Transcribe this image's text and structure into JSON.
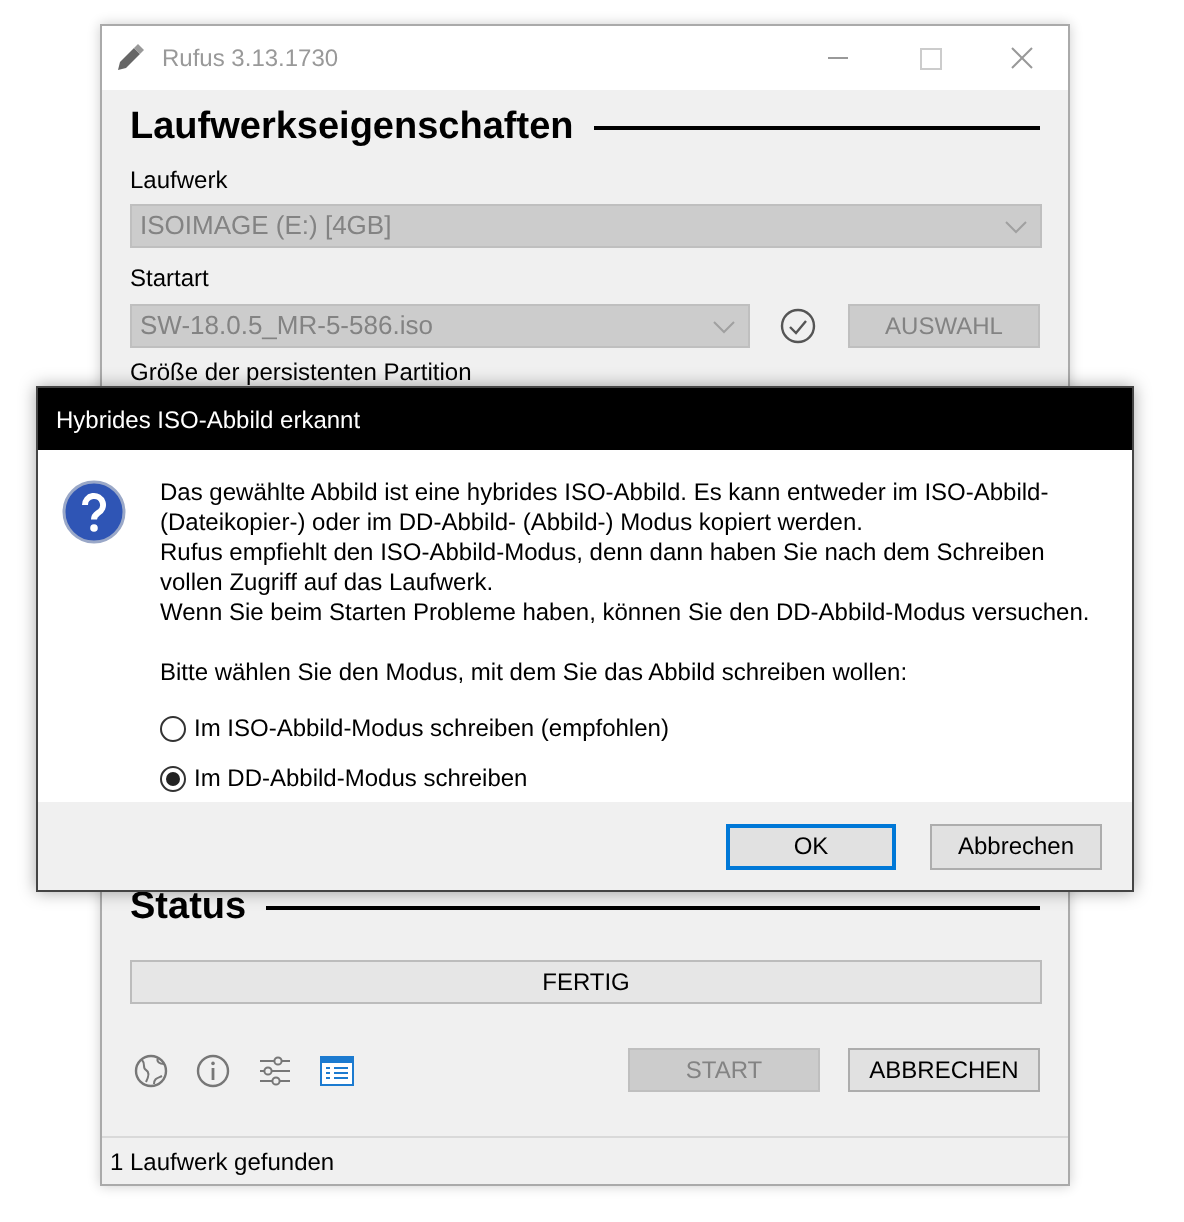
{
  "window": {
    "title": "Rufus 3.13.1730"
  },
  "drive_properties": {
    "heading": "Laufwerkseigenschaften",
    "device_label": "Laufwerk",
    "device": {
      "value": "ISOIMAGE (E:) [4GB]",
      "disabled": true
    },
    "boot_label": "Startart",
    "boot": {
      "value": "SW-18.0.5_MR-5-586.iso",
      "disabled": true
    },
    "select_button": {
      "label": "AUSWAHL",
      "disabled": true
    },
    "persistent_label": "Größe der persistenten Partition"
  },
  "status": {
    "heading": "Status",
    "progress_text": "FERTIG",
    "start_button": {
      "label": "START",
      "disabled": true
    },
    "cancel_button": {
      "label": "ABBRECHEN",
      "disabled": false
    }
  },
  "status_bar": {
    "text": "1 Laufwerk gefunden"
  },
  "dialog": {
    "title": "Hybrides ISO-Abbild erkannt",
    "message_lines": [
      "Das gewählte Abbild ist eine hybrides ISO-Abbild. Es kann entweder im ISO-Abbild-",
      "(Dateikopier-) oder im DD-Abbild- (Abbild-) Modus kopiert werden.",
      "Rufus empfiehlt den ISO-Abbild-Modus, denn dann haben Sie nach dem Schreiben",
      "vollen Zugriff auf das Laufwerk.",
      "Wenn Sie beim Starten Probleme haben, können Sie den DD-Abbild-Modus versuchen."
    ],
    "prompt": "Bitte wählen Sie den Modus, mit dem Sie das Abbild schreiben wollen:",
    "options": [
      {
        "label": "Im ISO-Abbild-Modus schreiben (empfohlen)",
        "selected": false
      },
      {
        "label": "Im DD-Abbild-Modus schreiben",
        "selected": true
      }
    ],
    "buttons": [
      {
        "label": "OK",
        "default": true
      },
      {
        "label": "Abbrechen",
        "default": false
      }
    ]
  }
}
